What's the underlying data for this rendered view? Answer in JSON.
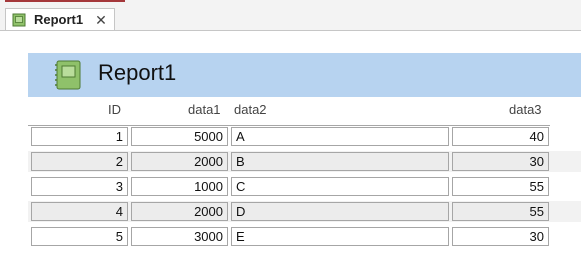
{
  "tab": {
    "title": "Report1",
    "close": "✕"
  },
  "report": {
    "title": "Report1"
  },
  "columns": {
    "id": "ID",
    "data1": "data1",
    "data2": "data2",
    "data3": "data3"
  },
  "rows": [
    {
      "id": "1",
      "data1": "5000",
      "data2": "A",
      "data3": "40"
    },
    {
      "id": "2",
      "data1": "2000",
      "data2": "B",
      "data3": "30"
    },
    {
      "id": "3",
      "data1": "1000",
      "data2": "C",
      "data3": "55"
    },
    {
      "id": "4",
      "data1": "2000",
      "data2": "D",
      "data3": "55"
    },
    {
      "id": "5",
      "data1": "3000",
      "data2": "E",
      "data3": "30"
    }
  ],
  "colors": {
    "header_band": "#b7d3f0",
    "alt_row": "#ececec",
    "icon_green": "#8fc16a"
  }
}
